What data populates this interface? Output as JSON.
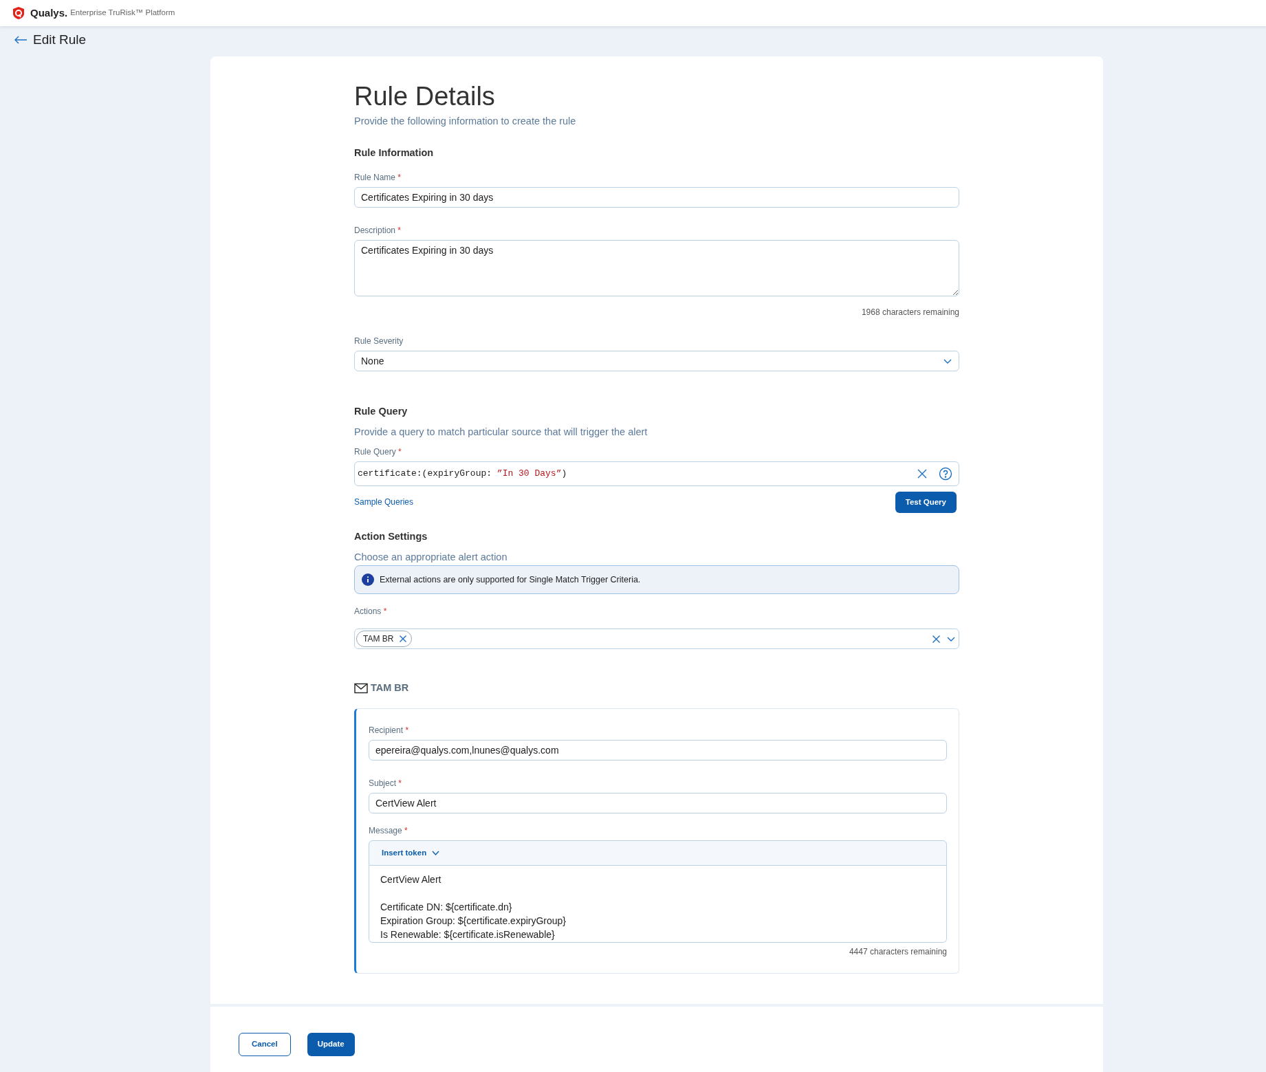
{
  "header": {
    "brand": "Qualys.",
    "product": "Enterprise TruRisk™ Platform"
  },
  "page": {
    "title": "Edit Rule"
  },
  "form": {
    "title": "Rule Details",
    "subtitle": "Provide the following information to create the rule",
    "rule_information": {
      "heading": "Rule Information",
      "rule_name": {
        "label": "Rule Name",
        "required_mark": "*",
        "value": "Certificates Expiring in 30 days"
      },
      "description": {
        "label": "Description",
        "required_mark": "*",
        "value": "Certificates Expiring in 30 days",
        "remaining": "1968 characters remaining"
      },
      "severity": {
        "label": "Rule Severity",
        "value": "None"
      }
    },
    "rule_query": {
      "heading": "Rule Query",
      "subtitle": "Provide a query to match particular source that will trigger the alert",
      "label": "Rule Query",
      "required_mark": "*",
      "query_parts": [
        {
          "kind": "code",
          "text": "certificate:(expiryGroup: "
        },
        {
          "kind": "string",
          "text": "”In 30 Days”"
        },
        {
          "kind": "code",
          "text": ")"
        }
      ],
      "sample_link": "Sample Queries",
      "test_button": "Test Query"
    },
    "action_settings": {
      "heading": "Action Settings",
      "subtitle": "Choose an appropriate alert action",
      "info": "External actions are only supported for Single Match Trigger Criteria.",
      "actions_label": "Actions",
      "required_mark": "*",
      "actions": [
        {
          "label": "TAM BR"
        }
      ],
      "email_action": {
        "title": "TAM BR",
        "recipient": {
          "label": "Recipient",
          "required_mark": "*",
          "value": "epereira@qualys.com,lnunes@qualys.com"
        },
        "subject": {
          "label": "Subject",
          "required_mark": "*",
          "value": "CertView Alert"
        },
        "message": {
          "label": "Message",
          "required_mark": "*",
          "insert_token": "Insert token",
          "paragraphs": [
            [
              "CertView Alert"
            ],
            [
              "Certificate DN: ${certificate.dn}",
              "Expiration Group: ${certificate.expiryGroup}",
              "Is Renewable: ${certificate.isRenewable}"
            ]
          ],
          "remaining": "4447 characters remaining"
        }
      }
    }
  },
  "footer": {
    "buttons": [
      {
        "kind": "secondary",
        "label": "Cancel"
      },
      {
        "kind": "primary",
        "label": "Update"
      }
    ]
  }
}
